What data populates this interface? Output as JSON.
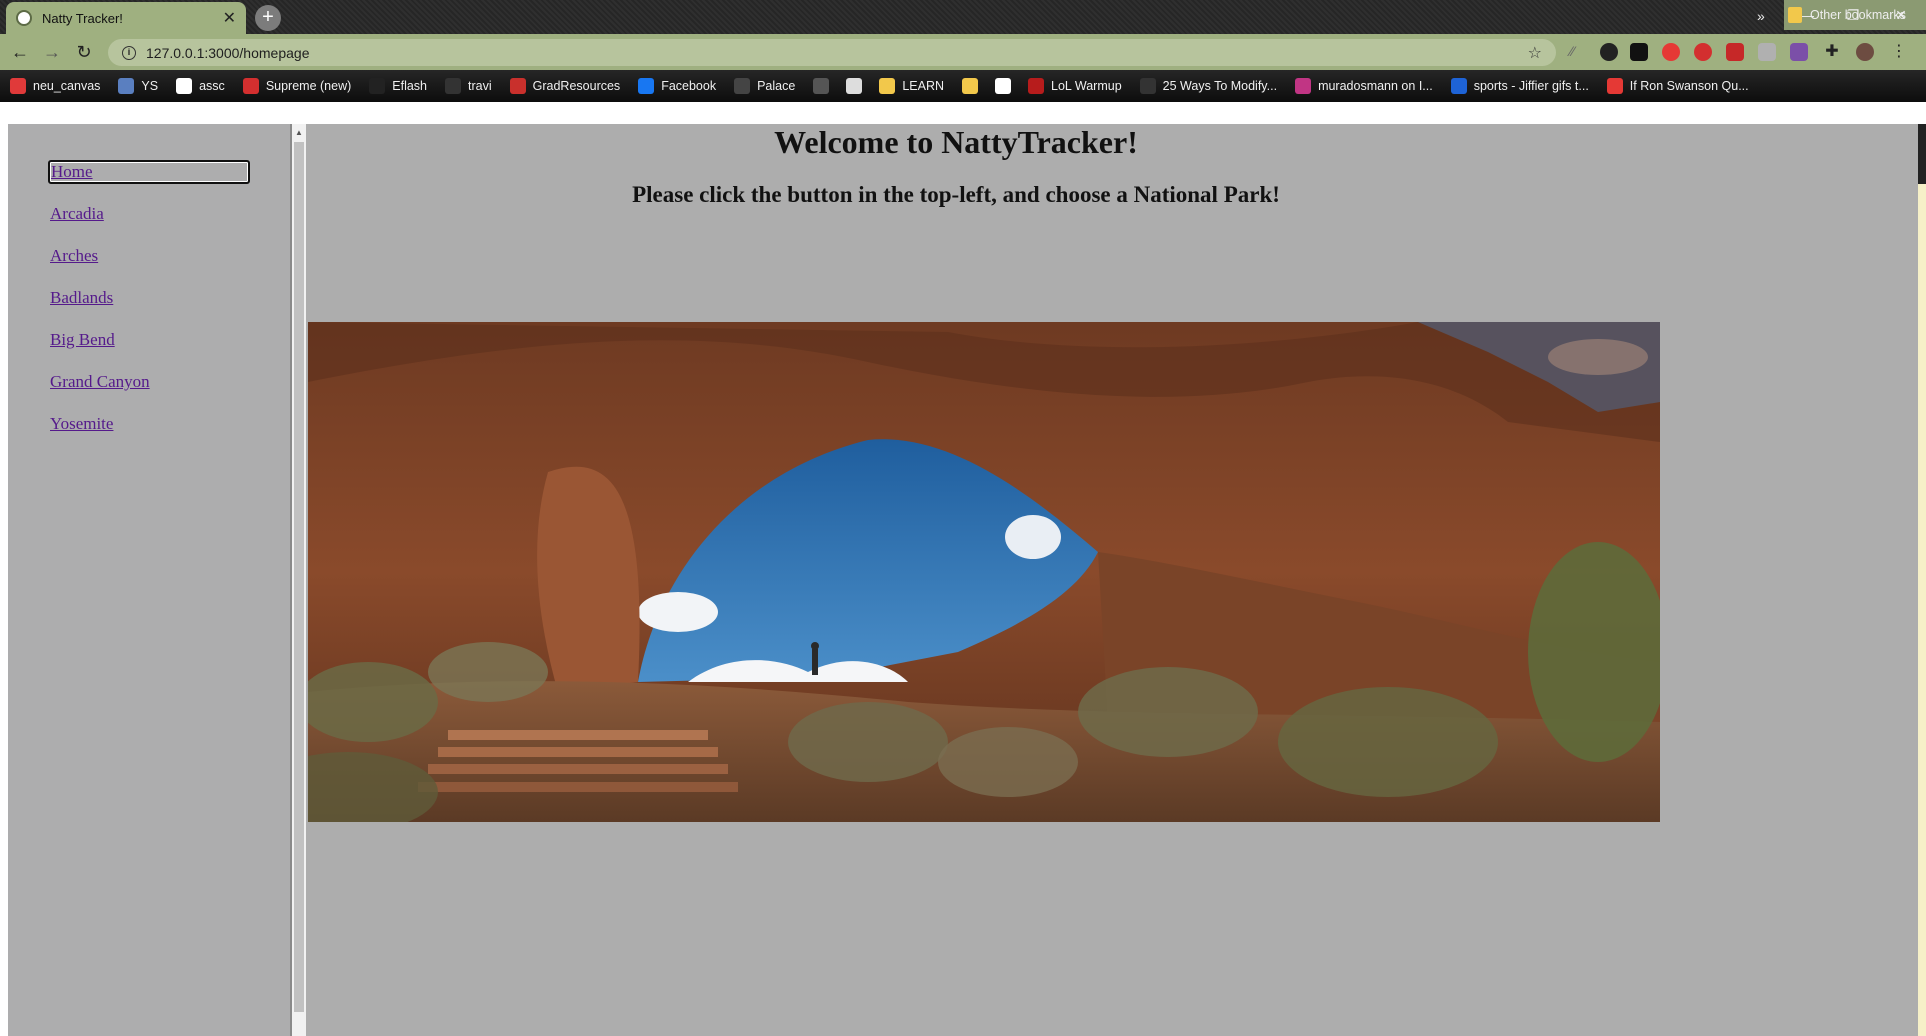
{
  "browser": {
    "tab_title": "Natty Tracker!",
    "tab_close": "✕",
    "new_tab": "+",
    "window_controls": {
      "minimize": "—",
      "maximize": "❐",
      "close": "✕"
    },
    "url": "127.0.0.1:3000/homepage",
    "bookmarks": [
      {
        "label": "neu_canvas",
        "color": "#e03a3a"
      },
      {
        "label": "YS",
        "color": "#5a7fc0"
      },
      {
        "label": "assc",
        "color": "#ffffff"
      },
      {
        "label": "Supreme (new)",
        "color": "#d32f2f"
      },
      {
        "label": "Eflash",
        "color": "#222222"
      },
      {
        "label": "travi",
        "color": "#333333"
      },
      {
        "label": "GradResources",
        "color": "#c9302c"
      },
      {
        "label": "Facebook",
        "color": "#1877f2"
      },
      {
        "label": "Palace",
        "color": "#444444"
      },
      {
        "label": "",
        "color": "#555555"
      },
      {
        "label": "",
        "color": "#dddddd"
      },
      {
        "label": "LEARN",
        "color": "#f2c84b"
      },
      {
        "label": "",
        "color": "#f2c84b"
      },
      {
        "label": "",
        "color": "#ffffff"
      },
      {
        "label": "LoL Warmup",
        "color": "#b71c1c"
      },
      {
        "label": "25 Ways To Modify...",
        "color": "#333333"
      },
      {
        "label": "muradosmann on I...",
        "color": "#c13584"
      },
      {
        "label": "sports - Jiffier gifs t...",
        "color": "#1e63d6"
      },
      {
        "label": "If Ron Swanson Qu...",
        "color": "#e53935"
      }
    ],
    "bookmarks_overflow": "»",
    "other_bookmarks": "Other bookmarks"
  },
  "sidebar": {
    "collapse_icon": "»",
    "links": [
      "Home",
      "Arcadia",
      "Arches",
      "Badlands",
      "Big Bend",
      "Grand Canyon",
      "Yosemite"
    ],
    "active": "Home"
  },
  "main": {
    "heading": "Welcome to NattyTracker!",
    "subheading": "Please click the button in the top-left, and choose a National Park!"
  },
  "colors": {
    "browser_accent": "#9fb080",
    "sidebar_bg": "#adadae",
    "main_bg": "#adadad",
    "link": "#551a8b"
  }
}
